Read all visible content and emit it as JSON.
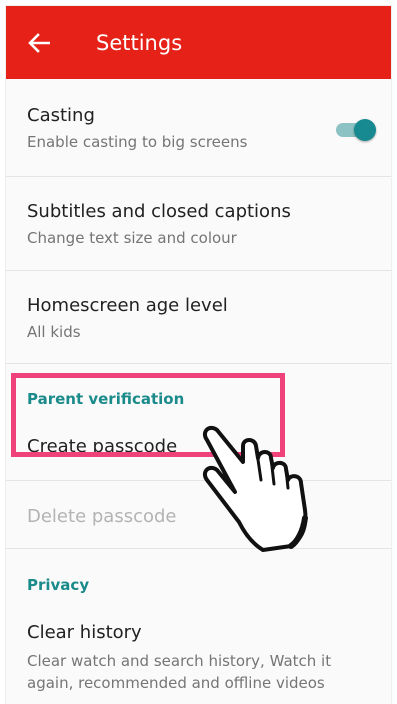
{
  "appbar": {
    "title": "Settings",
    "color": "#e62117",
    "back_icon": "arrow-left-icon"
  },
  "settings": {
    "casting": {
      "title": "Casting",
      "subtitle": "Enable casting to big screens",
      "toggle_on": true,
      "toggle_color": "#168a90"
    },
    "subtitles": {
      "title": "Subtitles and closed captions",
      "subtitle": "Change text size and colour"
    },
    "age_level": {
      "title": "Homescreen age level",
      "subtitle": "All kids"
    },
    "parent_verification": {
      "section_title": "Parent verification",
      "create_passcode": "Create passcode",
      "delete_passcode": "Delete passcode",
      "delete_disabled": true
    },
    "privacy": {
      "section_title": "Privacy",
      "clear_history": {
        "title": "Clear history",
        "subtitle": "Clear watch and search history, Watch it again, recommended and offline videos"
      }
    }
  },
  "annotations": {
    "highlight_color": "#f0427a",
    "pointer_icon": "pointing-hand-icon"
  }
}
